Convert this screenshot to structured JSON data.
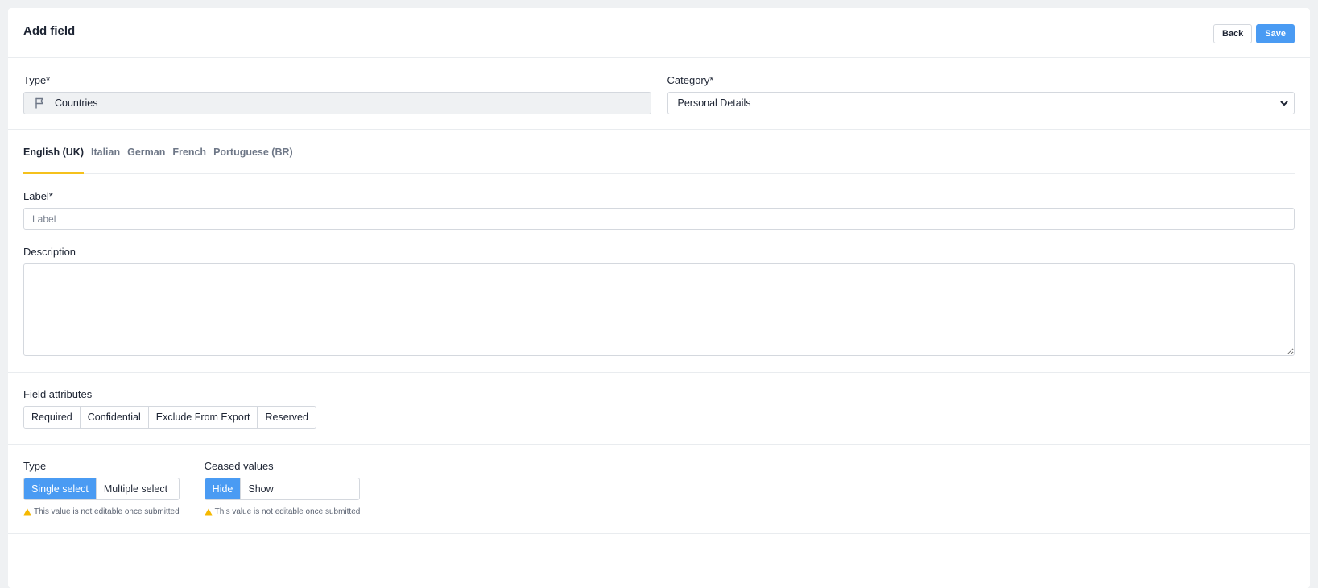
{
  "header": {
    "title": "Add field",
    "back_label": "Back",
    "save_label": "Save"
  },
  "type_field": {
    "label": "Type*",
    "value": "Countries",
    "icon": "flag-icon"
  },
  "category_field": {
    "label": "Category*",
    "value": "Personal Details",
    "icon": "chevron-down-icon"
  },
  "language_tabs": [
    {
      "label": "English (UK)",
      "active": true
    },
    {
      "label": "Italian",
      "active": false
    },
    {
      "label": "German",
      "active": false
    },
    {
      "label": "French",
      "active": false
    },
    {
      "label": "Portuguese (BR)",
      "active": false
    }
  ],
  "label_field": {
    "label": "Label*",
    "placeholder": "Label",
    "value": ""
  },
  "description_field": {
    "label": "Description",
    "value": ""
  },
  "field_attributes": {
    "label": "Field attributes",
    "options": [
      "Required",
      "Confidential",
      "Exclude From Export",
      "Reserved"
    ]
  },
  "select_type": {
    "label": "Type",
    "options": [
      "Single select",
      "Multiple select"
    ],
    "selected": "Single select",
    "warning": "This value is not editable once submitted"
  },
  "ceased_values": {
    "label": "Ceased values",
    "options": [
      "Hide",
      "Show"
    ],
    "selected": "Hide",
    "warning": "This value is not editable once submitted"
  },
  "colors": {
    "accent": "#4a9bf3",
    "tab_indicator": "#f5c11c",
    "warning": "#f5b800"
  }
}
